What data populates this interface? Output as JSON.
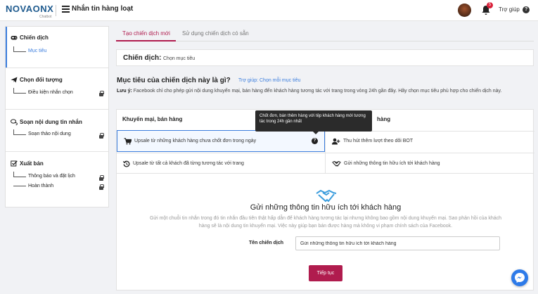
{
  "header": {
    "logo": "NOVAONX",
    "logo_sub": "Chatbot",
    "title": "Nhắn tin hàng loạt",
    "notif_count": "5",
    "help_label": "Trợ giúp",
    "help_icon": "?"
  },
  "sidebar": {
    "steps": [
      {
        "title": "Chiến dịch",
        "items": [
          {
            "label": "Mục tiêu",
            "locked": false
          }
        ]
      },
      {
        "title": "Chọn đối tượng",
        "items": [
          {
            "label": "Điều kiện nhắn chọn",
            "locked": true
          }
        ]
      },
      {
        "title": "Soạn nội dung tin nhắn",
        "items": [
          {
            "label": "Soạn thảo nội dung",
            "locked": true
          }
        ]
      },
      {
        "title": "Xuất bản",
        "items": [
          {
            "label": "Thông báo và đặt lịch",
            "locked": true
          },
          {
            "label": "Hoàn thành",
            "locked": true
          }
        ]
      }
    ]
  },
  "tabs": [
    {
      "label": "Tạo chiến dịch mới",
      "active": true
    },
    {
      "label": "Sử dụng chiến dịch có sẵn",
      "active": false
    }
  ],
  "campaign": {
    "label": "Chiến dịch:",
    "value": "Chọn mục tiêu"
  },
  "goal": {
    "title": "Mục tiêu của chiến dịch này là gì?",
    "help_link": "Trợ giúp: Chọn mỗi mục tiêu",
    "note_label": "Lưu ý:",
    "note_text": " Facebook chỉ cho phép gửi nội dung khuyến mại, bán hàng đến khách hàng tương tác với trang trong vòng 24h gần đây. Hãy chọn mục tiêu phù hợp cho chiến dịch này."
  },
  "columns": {
    "left_header": "Khuyến mại, bán hàng",
    "right_header": "hàng"
  },
  "options": [
    {
      "label": "Upsale từ những khách hàng chưa chốt đơn trong ngày",
      "icon": "cart-icon",
      "selected": true
    },
    {
      "label": "Thu hút thêm lượt theo dõi BOT",
      "icon": "user-plus-icon",
      "selected": false
    },
    {
      "label": "Upsale từ tất cả khách đã từng tương tác với trang",
      "icon": "history-icon",
      "selected": false
    },
    {
      "label": "Gửi những thông tin hữu ích tới khách hàng",
      "icon": "handshake-icon",
      "selected": false
    }
  ],
  "option_help_icon": "?",
  "tooltip": "Chốt đơn, bán thêm hàng với tệp khách hàng mới tương tác trong 24h gần nhất",
  "detail": {
    "title": "Gửi những thông tin hữu ích tới khách hàng",
    "desc": "Gửi một chuỗi tin nhắn trong đó tin nhắn đầu tiên thật hấp dẫn để khách hàng tương tác lại nhưng không bao gồm nội dung khuyến mại. Sao phản hồi của khách hàng sẽ là nội dung tin khuyến mại. Việc này giúp bạn bán được hàng mà không vi phạm chính sách của Facebook.",
    "field_label": "Tên chiến dịch",
    "field_value": "Gửi những thông tin hữu ích tới khách hàng",
    "button": "Tiếp tục"
  },
  "colors": {
    "brand": "#1e5a8e",
    "accent": "#b01c4e",
    "link": "#3b7ddd",
    "badge": "#d9213a",
    "messenger": "#2e7be9"
  }
}
